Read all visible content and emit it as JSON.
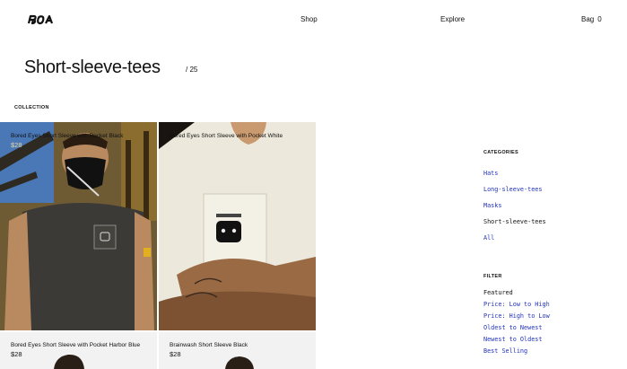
{
  "header": {
    "logo_text": "BOA",
    "nav": {
      "shop": "Shop",
      "explore": "Explore",
      "bag_label": "Bag",
      "bag_count": "0"
    }
  },
  "page": {
    "title": "Short-sleeve-tees",
    "count": "/ 25",
    "collection_label": "COLLECTION"
  },
  "products": [
    {
      "name": "Bored Eyes Short Sleeve with Pocket Black",
      "price": "$28"
    },
    {
      "name": "Bored Eyes Short Sleeve with Pocket White",
      "price": ""
    },
    {
      "name": "Bored Eyes Short Sleeve with Pocket Harbor Blue",
      "price": "$28"
    },
    {
      "name": "Brainwash Short Sleeve Black",
      "price": "$28"
    }
  ],
  "sidebar": {
    "categories_heading": "CATEGORIES",
    "categories": [
      "Hats",
      "Long-sleeve-tees",
      "Masks",
      "Short-sleeve-tees",
      "All"
    ],
    "filter_heading": "FILTER",
    "filters": [
      "Featured",
      "Price: Low to High",
      "Price: High to Low",
      "Oldest to Newest",
      "Newest to Oldest",
      "Best Selling"
    ]
  },
  "colors": {
    "link": "#2233bb",
    "text": "#111111",
    "card_bg": "#f2f2f2"
  }
}
